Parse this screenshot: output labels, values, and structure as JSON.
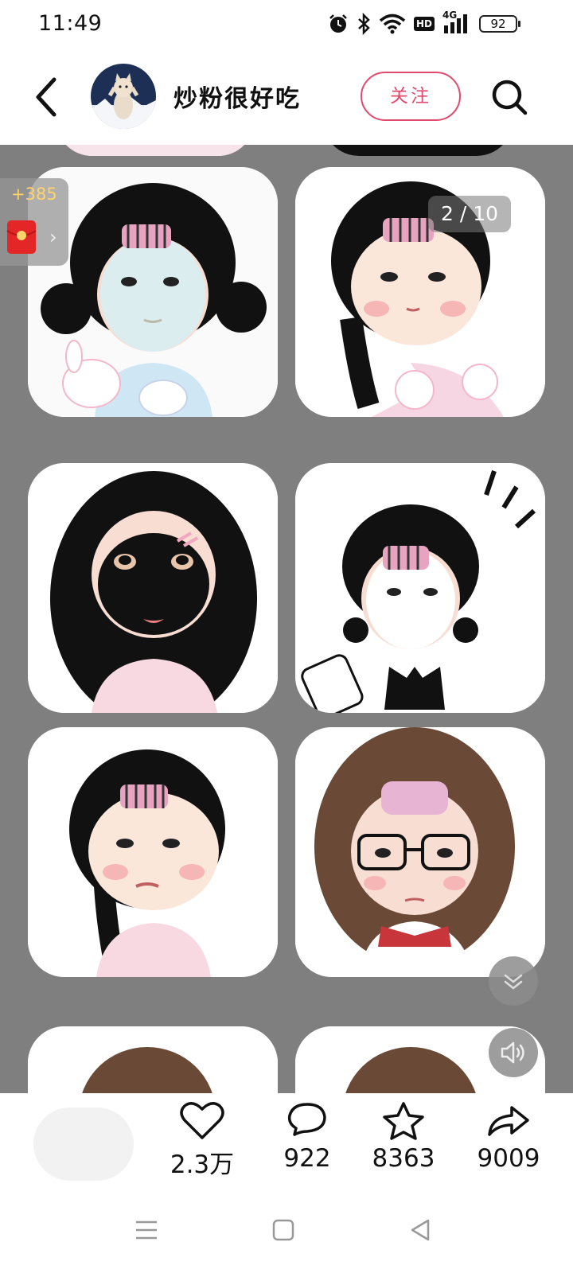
{
  "status_bar": {
    "time": "11:49",
    "network_badge": "HD",
    "network_type": "4G",
    "battery": "92",
    "icons": [
      "alarm-icon",
      "bluetooth-icon",
      "wifi-icon",
      "hd-icon",
      "signal-icon",
      "battery-icon"
    ]
  },
  "header": {
    "author_name": "炒粉很好吃",
    "follow_label": "关注",
    "icons": [
      "back-icon",
      "search-icon"
    ]
  },
  "gallery": {
    "page_indicator": "2 / 10"
  },
  "reward": {
    "count": "+385",
    "chevron": "›"
  },
  "actions": {
    "likes": "2.3万",
    "comments": "922",
    "favorites": "8363",
    "shares": "9009"
  },
  "colors": {
    "accent": "#e14a6e",
    "overlay_gray": "#7f7f7f",
    "reward_gold": "#ffd36b"
  }
}
